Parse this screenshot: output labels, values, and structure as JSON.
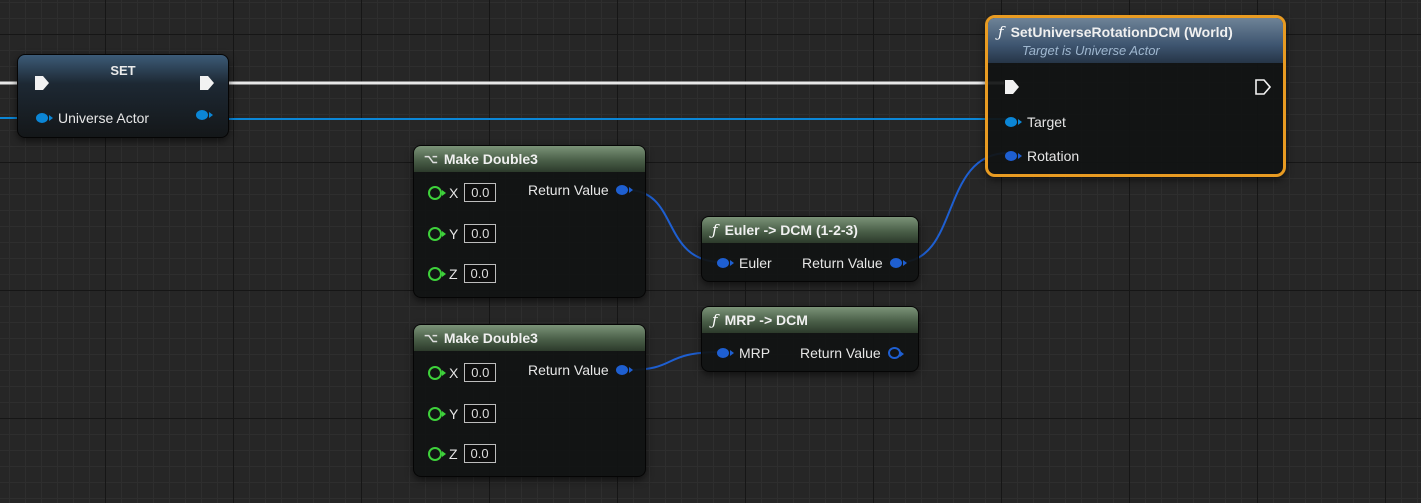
{
  "set_node": {
    "title": "SET",
    "pin_label": "Universe Actor"
  },
  "set_rotation_node": {
    "title": "SetUniverseRotationDCM (World)",
    "subtitle": "Target is Universe Actor",
    "pins": {
      "target": "Target",
      "rotation": "Rotation"
    }
  },
  "make_double3_a": {
    "title": "Make Double3",
    "output": "Return Value",
    "inputs": [
      {
        "label": "X",
        "value": "0.0"
      },
      {
        "label": "Y",
        "value": "0.0"
      },
      {
        "label": "Z",
        "value": "0.0"
      }
    ]
  },
  "make_double3_b": {
    "title": "Make Double3",
    "output": "Return Value",
    "inputs": [
      {
        "label": "X",
        "value": "0.0"
      },
      {
        "label": "Y",
        "value": "0.0"
      },
      {
        "label": "Z",
        "value": "0.0"
      }
    ]
  },
  "euler_node": {
    "title": "Euler -> DCM (1-2-3)",
    "input": "Euler",
    "output": "Return Value"
  },
  "mrp_node": {
    "title": "MRP -> DCM",
    "input": "MRP",
    "output": "Return Value"
  },
  "colors": {
    "exec_wire": "#e8e8e8",
    "object_wire": "#0b86d6",
    "struct_wire": "#1e5fd1",
    "selection": "#e89b22",
    "float_pin": "#3ed13b"
  },
  "icons": {
    "function": "function-icon",
    "make_struct": "make-struct-icon",
    "exec": "exec-pin-icon"
  }
}
